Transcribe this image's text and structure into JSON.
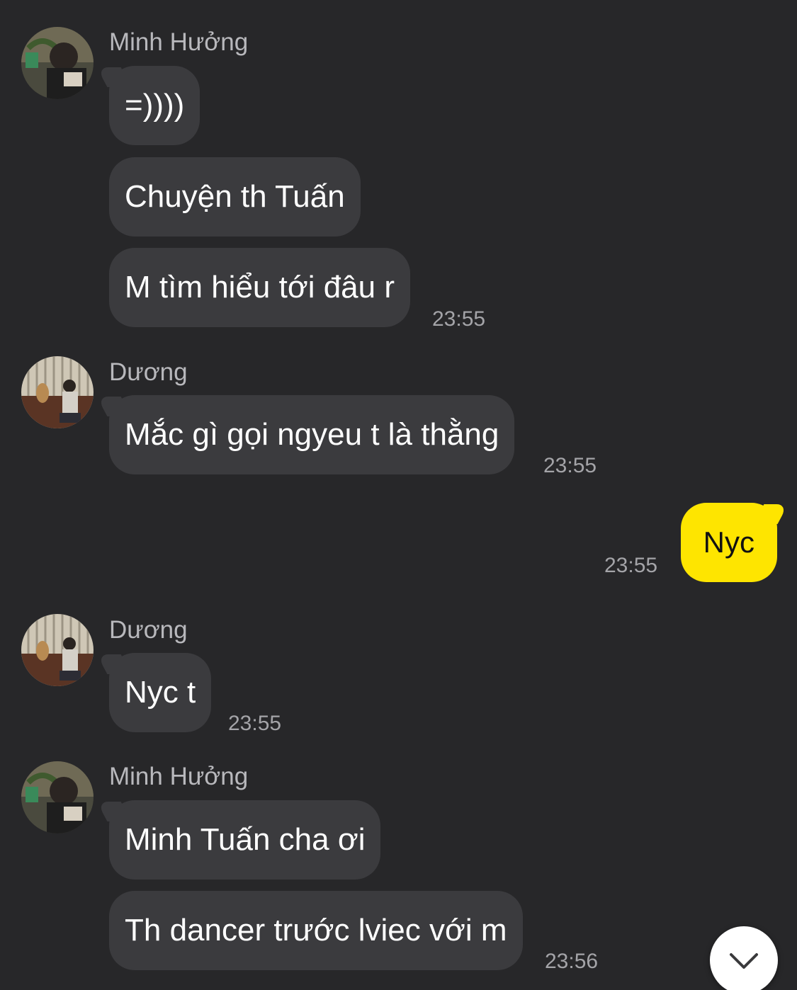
{
  "messages": [
    {
      "sender": "Minh Hưởng",
      "bubbles": [
        "=))))",
        "Chuyện th Tuấn",
        "M tìm hiểu tới đâu r"
      ],
      "time": "23:55"
    },
    {
      "sender": "Dương",
      "bubbles": [
        "Mắc gì gọi ngyeu t là thằng"
      ],
      "time": "23:55"
    },
    {
      "sender": "me",
      "bubbles": [
        "Nyc"
      ],
      "time": "23:55"
    },
    {
      "sender": "Dương",
      "bubbles": [
        "Nyc t"
      ],
      "time": "23:55"
    },
    {
      "sender": "Minh Hưởng",
      "bubbles": [
        "Minh Tuấn cha ơi",
        "Th dancer trước lviec với m"
      ],
      "time": "23:56"
    }
  ],
  "icons": {
    "scroll_down": "chevron-down-icon"
  },
  "colors": {
    "background": "#272729",
    "incoming_bubble": "#3b3b3e",
    "outgoing_bubble": "#fee500",
    "timestamp": "#a4a4a8"
  }
}
